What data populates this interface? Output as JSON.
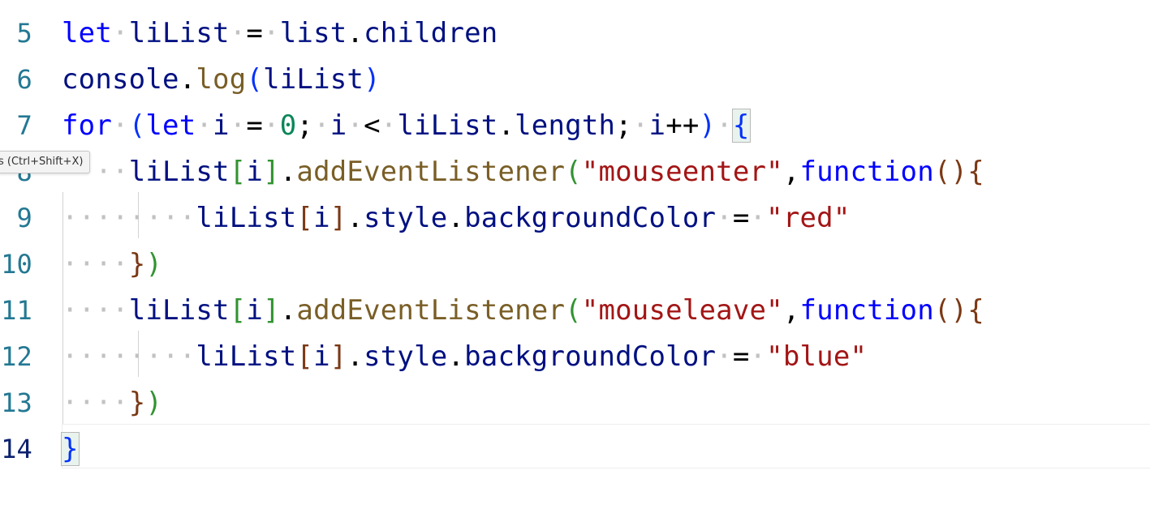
{
  "tooltip": {
    "text": "s (Ctrl+Shift+X)"
  },
  "lines": [
    {
      "number": "5",
      "tokens": [
        {
          "t": "let",
          "c": "kw"
        },
        {
          "t": "·",
          "c": "ws"
        },
        {
          "t": "liList",
          "c": "var"
        },
        {
          "t": "·",
          "c": "ws"
        },
        {
          "t": "=",
          "c": "pl"
        },
        {
          "t": "·",
          "c": "ws"
        },
        {
          "t": "list",
          "c": "var"
        },
        {
          "t": ".",
          "c": "pl"
        },
        {
          "t": "children",
          "c": "var"
        }
      ]
    },
    {
      "number": "6",
      "tokens": [
        {
          "t": "console",
          "c": "var"
        },
        {
          "t": ".",
          "c": "pl"
        },
        {
          "t": "log",
          "c": "fn"
        },
        {
          "t": "(",
          "c": "b1"
        },
        {
          "t": "liList",
          "c": "var"
        },
        {
          "t": ")",
          "c": "b1"
        }
      ]
    },
    {
      "number": "7",
      "tokens": [
        {
          "t": "for",
          "c": "kw"
        },
        {
          "t": "·",
          "c": "ws"
        },
        {
          "t": "(",
          "c": "b1"
        },
        {
          "t": "let",
          "c": "kw"
        },
        {
          "t": "·",
          "c": "ws"
        },
        {
          "t": "i",
          "c": "var"
        },
        {
          "t": "·",
          "c": "ws"
        },
        {
          "t": "=",
          "c": "pl"
        },
        {
          "t": "·",
          "c": "ws"
        },
        {
          "t": "0",
          "c": "num"
        },
        {
          "t": ";",
          "c": "pl"
        },
        {
          "t": "·",
          "c": "ws"
        },
        {
          "t": "i",
          "c": "var"
        },
        {
          "t": "·",
          "c": "ws"
        },
        {
          "t": "<",
          "c": "pl"
        },
        {
          "t": "·",
          "c": "ws"
        },
        {
          "t": "liList",
          "c": "var"
        },
        {
          "t": ".",
          "c": "pl"
        },
        {
          "t": "length",
          "c": "var"
        },
        {
          "t": ";",
          "c": "pl"
        },
        {
          "t": "·",
          "c": "ws"
        },
        {
          "t": "i",
          "c": "var"
        },
        {
          "t": "++",
          "c": "pl"
        },
        {
          "t": ")",
          "c": "b1"
        },
        {
          "t": "·",
          "c": "ws"
        },
        {
          "t": "{",
          "c": "b1 matchbr"
        }
      ]
    },
    {
      "number": "8",
      "tokens": [
        {
          "t": "····",
          "c": "ws"
        },
        {
          "t": "liList",
          "c": "var"
        },
        {
          "t": "[",
          "c": "b2"
        },
        {
          "t": "i",
          "c": "var"
        },
        {
          "t": "]",
          "c": "b2"
        },
        {
          "t": ".",
          "c": "pl"
        },
        {
          "t": "addEventListener",
          "c": "fn"
        },
        {
          "t": "(",
          "c": "b2"
        },
        {
          "t": "\"mouseenter\"",
          "c": "str"
        },
        {
          "t": ",",
          "c": "pl"
        },
        {
          "t": "function",
          "c": "kw"
        },
        {
          "t": "()",
          "c": "b3"
        },
        {
          "t": "{",
          "c": "b3"
        }
      ]
    },
    {
      "number": "9",
      "tokens": [
        {
          "t": "········",
          "c": "ws"
        },
        {
          "t": "liList",
          "c": "var"
        },
        {
          "t": "[",
          "c": "b3"
        },
        {
          "t": "i",
          "c": "var"
        },
        {
          "t": "]",
          "c": "b3"
        },
        {
          "t": ".",
          "c": "pl"
        },
        {
          "t": "style",
          "c": "var"
        },
        {
          "t": ".",
          "c": "pl"
        },
        {
          "t": "backgroundColor",
          "c": "var"
        },
        {
          "t": "·",
          "c": "ws"
        },
        {
          "t": "=",
          "c": "pl"
        },
        {
          "t": "·",
          "c": "ws"
        },
        {
          "t": "\"red\"",
          "c": "str"
        }
      ]
    },
    {
      "number": "10",
      "tokens": [
        {
          "t": "····",
          "c": "ws"
        },
        {
          "t": "}",
          "c": "b3"
        },
        {
          "t": ")",
          "c": "b2"
        }
      ]
    },
    {
      "number": "11",
      "tokens": [
        {
          "t": "····",
          "c": "ws"
        },
        {
          "t": "liList",
          "c": "var"
        },
        {
          "t": "[",
          "c": "b2"
        },
        {
          "t": "i",
          "c": "var"
        },
        {
          "t": "]",
          "c": "b2"
        },
        {
          "t": ".",
          "c": "pl"
        },
        {
          "t": "addEventListener",
          "c": "fn"
        },
        {
          "t": "(",
          "c": "b2"
        },
        {
          "t": "\"mouseleave\"",
          "c": "str"
        },
        {
          "t": ",",
          "c": "pl"
        },
        {
          "t": "function",
          "c": "kw"
        },
        {
          "t": "()",
          "c": "b3"
        },
        {
          "t": "{",
          "c": "b3"
        }
      ]
    },
    {
      "number": "12",
      "tokens": [
        {
          "t": "········",
          "c": "ws"
        },
        {
          "t": "liList",
          "c": "var"
        },
        {
          "t": "[",
          "c": "b3"
        },
        {
          "t": "i",
          "c": "var"
        },
        {
          "t": "]",
          "c": "b3"
        },
        {
          "t": ".",
          "c": "pl"
        },
        {
          "t": "style",
          "c": "var"
        },
        {
          "t": ".",
          "c": "pl"
        },
        {
          "t": "backgroundColor",
          "c": "var"
        },
        {
          "t": "·",
          "c": "ws"
        },
        {
          "t": "=",
          "c": "pl"
        },
        {
          "t": "·",
          "c": "ws"
        },
        {
          "t": "\"blue\"",
          "c": "str"
        }
      ]
    },
    {
      "number": "13",
      "tokens": [
        {
          "t": "····",
          "c": "ws"
        },
        {
          "t": "}",
          "c": "b3"
        },
        {
          "t": ")",
          "c": "b2"
        }
      ]
    },
    {
      "number": "14",
      "active": true,
      "tokens": [
        {
          "t": "}",
          "c": "b1 matchbr"
        }
      ]
    }
  ]
}
